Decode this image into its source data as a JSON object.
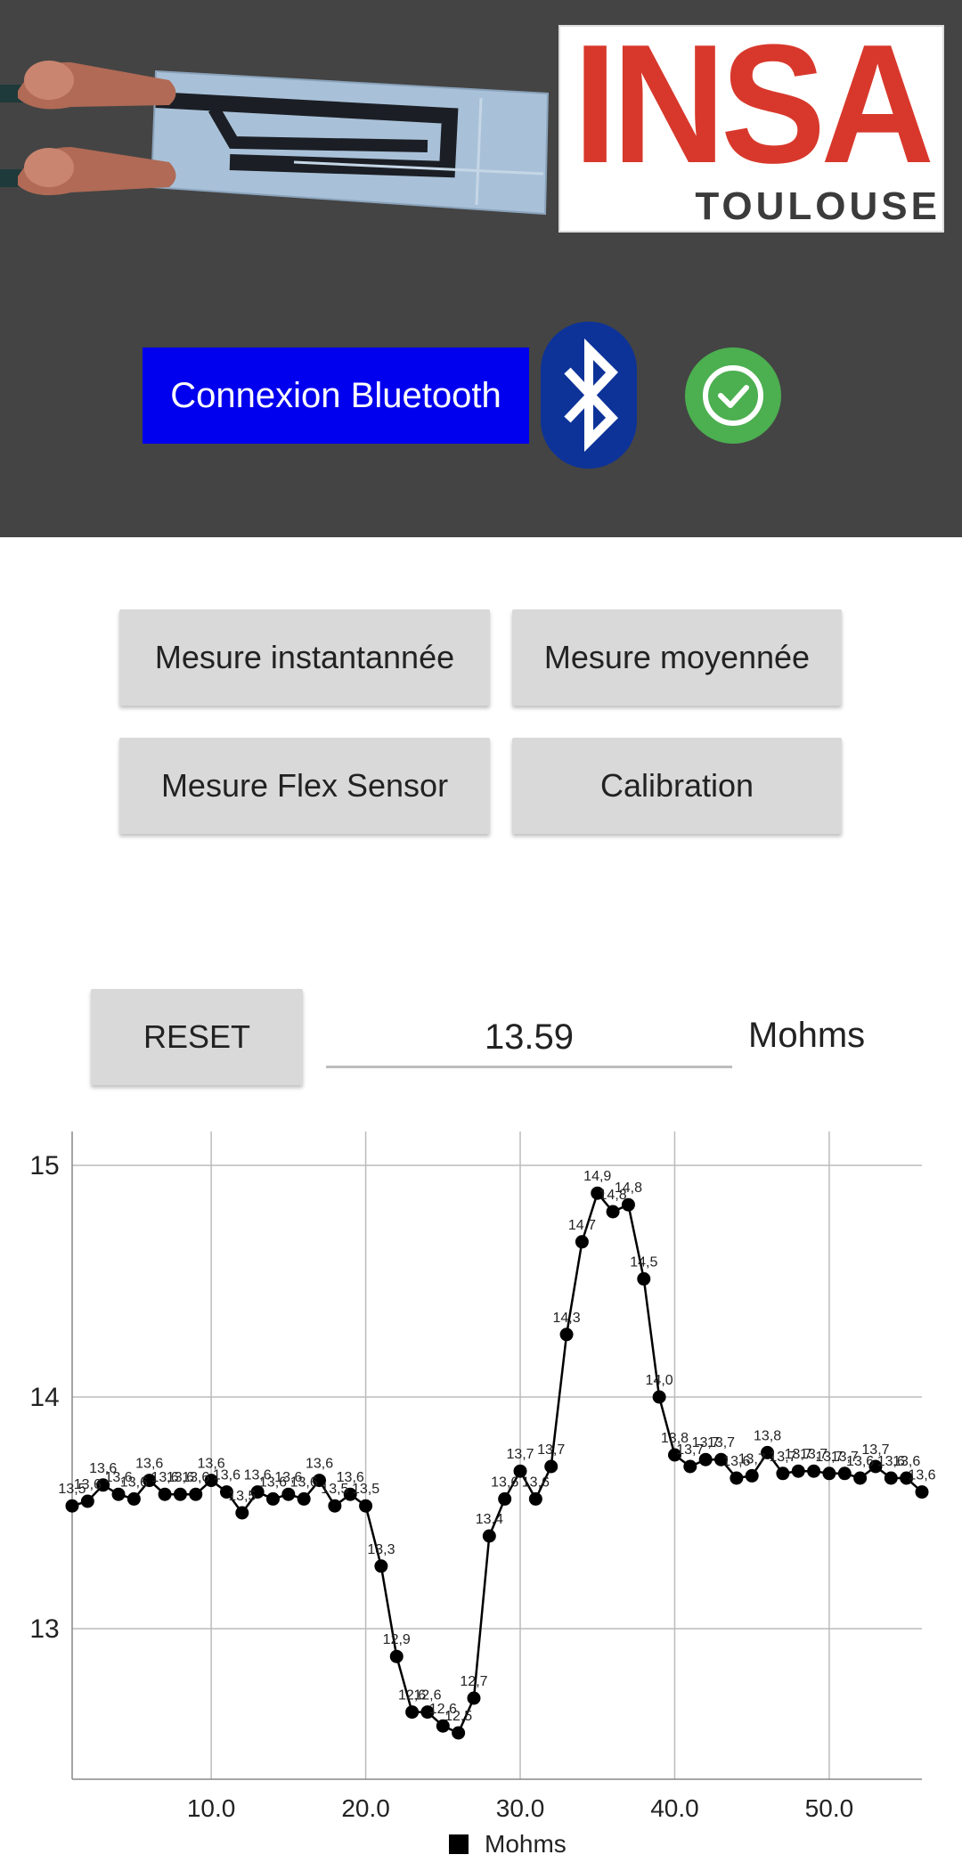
{
  "header": {
    "logo_text": "INSA",
    "logo_subtext": "TOULOUSE",
    "bluetooth_button_label": "Connexion Bluetooth",
    "connection_status": "connected",
    "colors": {
      "header_bg": "#444444",
      "bluetooth_button": "#0000ee",
      "status_ok": "#4caf50",
      "logo_red": "#d8382c"
    }
  },
  "buttons": {
    "instant": "Mesure instantannée",
    "average": "Mesure moyennée",
    "flex": "Mesure Flex Sensor",
    "calibration": "Calibration",
    "reset": "RESET"
  },
  "reading": {
    "value": "13.59",
    "unit": "Mohms"
  },
  "chart_data": {
    "type": "line",
    "title": "",
    "xlabel": "",
    "ylabel": "",
    "xlim": [
      1,
      56
    ],
    "ylim": [
      12.35,
      15.1
    ],
    "x_ticks": [
      "10.0",
      "20.0",
      "30.0",
      "40.0",
      "50.0"
    ],
    "x_tick_values": [
      10,
      20,
      30,
      40,
      50
    ],
    "y_ticks": [
      "13",
      "14",
      "15"
    ],
    "y_tick_values": [
      13,
      14,
      15
    ],
    "grid": true,
    "legend": "bottom",
    "series": [
      {
        "name": "Mohms",
        "color": "#000000",
        "x": [
          1,
          2,
          3,
          4,
          5,
          6,
          7,
          8,
          9,
          10,
          11,
          12,
          13,
          14,
          15,
          16,
          17,
          18,
          19,
          20,
          21,
          22,
          23,
          24,
          25,
          26,
          27,
          28,
          29,
          30,
          31,
          32,
          33,
          34,
          35,
          36,
          37,
          38,
          39,
          40,
          41,
          42,
          43,
          44,
          45,
          46,
          47,
          48,
          49,
          50,
          51,
          52,
          53,
          54,
          55,
          56
        ],
        "values": [
          13.53,
          13.55,
          13.62,
          13.58,
          13.56,
          13.64,
          13.58,
          13.58,
          13.58,
          13.64,
          13.59,
          13.5,
          13.59,
          13.56,
          13.58,
          13.56,
          13.64,
          13.53,
          13.58,
          13.53,
          13.27,
          12.88,
          12.64,
          12.64,
          12.58,
          12.55,
          12.7,
          13.4,
          13.56,
          13.68,
          13.56,
          13.7,
          14.27,
          14.67,
          14.88,
          14.8,
          14.83,
          14.51,
          14.0,
          13.75,
          13.7,
          13.73,
          13.73,
          13.65,
          13.66,
          13.76,
          13.67,
          13.68,
          13.68,
          13.67,
          13.67,
          13.65,
          13.7,
          13.65,
          13.65,
          13.59
        ],
        "labels": [
          "13,5",
          "13,6",
          "13,6",
          "13,6",
          "13,6",
          "13,6",
          "13,6",
          "13,6",
          "13,6",
          "13,6",
          "13,6",
          "13,5",
          "13,6",
          "13,6",
          "13,6",
          "13,6",
          "13,6",
          "13,5",
          "13,6",
          "13,5",
          "13,3",
          "12,9",
          "12,6",
          "12,6",
          "12,6",
          "12,5",
          "12,7",
          "13,4",
          "13,6",
          "13,7",
          "13,6",
          "13,7",
          "14,3",
          "14,7",
          "14,9",
          "14,8",
          "14,8",
          "14,5",
          "14,0",
          "13,8",
          "13,7",
          "13,7",
          "13,7",
          "13,6",
          "13,7",
          "13,8",
          "13,7",
          "13,7",
          "13,7",
          "13,7",
          "13,7",
          "13,6",
          "13,7",
          "13,6",
          "13,6",
          "13,6"
        ]
      }
    ]
  }
}
